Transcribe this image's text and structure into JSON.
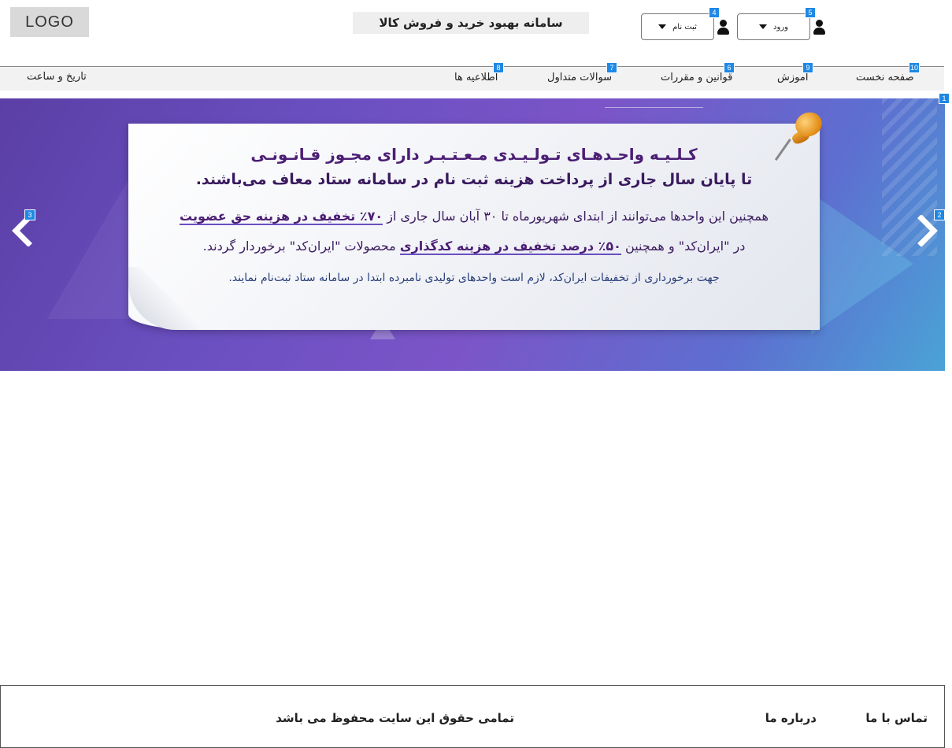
{
  "header": {
    "logo": "LOGO",
    "title": "سامانه بهبود خرید و فروش کالا",
    "login_label": "ورود",
    "register_label": "ثبت نام"
  },
  "nav": {
    "items": [
      {
        "label": "صفحه نخست",
        "badge": "10"
      },
      {
        "label": "آموزش",
        "badge": "9"
      },
      {
        "label": "قوانین و مقررات",
        "badge": "6"
      },
      {
        "label": "سوالات متداول",
        "badge": "7"
      },
      {
        "label": "اطلاعیه ها",
        "badge": "8"
      }
    ],
    "datetime_label": "تاریخ و ساعت"
  },
  "badges": {
    "login": "5",
    "register": "4",
    "slider": "1",
    "prev": "3",
    "next": "2"
  },
  "banner": {
    "line1": "کـلـیـه واحـدهـای تـولـیـدی مـعـتـبـر دارای مجـوز قـانـونـی",
    "line2": "تا پایان سال جاری از پرداخت هزینه ثبت نام در سامانه ستاد معاف می‌باشند.",
    "line3_text": "همچنین این واحدها می‌توانند از ابتدای شهریورماه تا ۳۰ آبان سال جاری از",
    "line3_emphasis": "۷۰٪ تخفیف در هزینه حق عضویت",
    "line4_prefix": "در \"ایران‌کد\" و همچنین",
    "line4_emphasis": "۵۰٪ درصد تخفیف در هزینه کدگذاری",
    "line4_suffix": "محصولات \"ایران‌کد\" برخوردار گردند.",
    "line5": "جهت برخورداری از تخفیفات ایران‌کد، لازم است واحدهای تولیدی نامبرده ابتدا در سامانه ستاد ثبت‌نام نمایند."
  },
  "footer": {
    "contact": "تماس با ما",
    "about": "درباره ما",
    "copyright": "تمامی حقوق این سایت محفوظ می باشد"
  },
  "colors": {
    "badge": "#1e88e5",
    "banner_text": "#4b1e74",
    "nav_bg": "#f2f2f2"
  }
}
